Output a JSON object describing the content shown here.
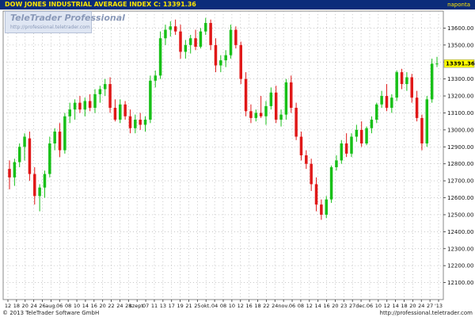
{
  "window": {
    "title": "DOW JONES INDUSTRIAL AVERAGE INDEX C: 13391.36",
    "period": "napontа"
  },
  "watermark": {
    "brand": "TeleTrader Professional",
    "url": "http://professional.teletrader.com"
  },
  "footer": {
    "copyright": "© 2013 TeleTrader Software GmbH",
    "url": "http://professional.teletrader.com"
  },
  "colors": {
    "header_bg": "#0b2c7a",
    "header_text": "#ffe600",
    "up_candle": "#18c018",
    "down_candle": "#e01818",
    "grid": "#b4b4b4",
    "price_tag": "#ffff00"
  },
  "chart_data": {
    "type": "candlestick",
    "title": "DOW JONES INDUSTRIAL AVERAGE INDEX",
    "last_price_label": "13391.36",
    "ylim": [
      12000,
      13700
    ],
    "y_ticks": [
      {
        "value": 13600,
        "label": "13600.00"
      },
      {
        "value": 13500,
        "label": "13500.00"
      },
      {
        "value": 13400,
        "label": "13400.00"
      },
      {
        "value": 13300,
        "label": "13300.00"
      },
      {
        "value": 13200,
        "label": "13200.00"
      },
      {
        "value": 13100,
        "label": "13100.00"
      },
      {
        "value": 13000,
        "label": "13000.00"
      },
      {
        "value": 12900,
        "label": "12900.00"
      },
      {
        "value": 12800,
        "label": "12800.00"
      },
      {
        "value": 12700,
        "label": "12700.00"
      },
      {
        "value": 12600,
        "label": "12600.00"
      },
      {
        "value": 12500,
        "label": "12500.00"
      },
      {
        "value": 12400,
        "label": "12400.00"
      },
      {
        "value": 12300,
        "label": "12300.00"
      },
      {
        "value": 12200,
        "label": "12200.00"
      },
      {
        "value": 12100,
        "label": "12100.00"
      }
    ],
    "x_labels": [
      "12",
      "18",
      "20",
      "24",
      "26",
      "aug.",
      "06",
      "08",
      "10",
      "14",
      "16",
      "20",
      "22",
      "24",
      "28",
      "szept.",
      "07",
      "11",
      "13",
      "17",
      "19",
      "21",
      "25",
      "okt.",
      "04",
      "08",
      "10",
      "12",
      "16",
      "18",
      "22",
      "24",
      "nov.",
      "06",
      "08",
      "12",
      "14",
      "16",
      "20",
      "23",
      "27",
      "dec.",
      "06",
      "10",
      "12",
      "14",
      "18",
      "20",
      "24",
      "27",
      "'13"
    ],
    "candles": [
      {
        "o": 12770,
        "h": 12820,
        "l": 12650,
        "c": 12720
      },
      {
        "o": 12720,
        "h": 12830,
        "l": 12670,
        "c": 12810
      },
      {
        "o": 12810,
        "h": 12920,
        "l": 12780,
        "c": 12900
      },
      {
        "o": 12900,
        "h": 12980,
        "l": 12820,
        "c": 12960
      },
      {
        "o": 12950,
        "h": 12990,
        "l": 12700,
        "c": 12740
      },
      {
        "o": 12740,
        "h": 12780,
        "l": 12560,
        "c": 12610
      },
      {
        "o": 12610,
        "h": 12680,
        "l": 12520,
        "c": 12660
      },
      {
        "o": 12660,
        "h": 12760,
        "l": 12600,
        "c": 12740
      },
      {
        "o": 12740,
        "h": 12960,
        "l": 12720,
        "c": 12920
      },
      {
        "o": 12920,
        "h": 13010,
        "l": 12880,
        "c": 12990
      },
      {
        "o": 12990,
        "h": 13040,
        "l": 12840,
        "c": 12880
      },
      {
        "o": 12880,
        "h": 13100,
        "l": 12860,
        "c": 13080
      },
      {
        "o": 13080,
        "h": 13160,
        "l": 13040,
        "c": 13120
      },
      {
        "o": 13120,
        "h": 13180,
        "l": 13060,
        "c": 13160
      },
      {
        "o": 13160,
        "h": 13200,
        "l": 13100,
        "c": 13120
      },
      {
        "o": 13120,
        "h": 13190,
        "l": 13080,
        "c": 13170
      },
      {
        "o": 13170,
        "h": 13210,
        "l": 13110,
        "c": 13130
      },
      {
        "o": 13130,
        "h": 13240,
        "l": 13100,
        "c": 13210
      },
      {
        "o": 13210,
        "h": 13260,
        "l": 13160,
        "c": 13240
      },
      {
        "o": 13240,
        "h": 13300,
        "l": 13200,
        "c": 13270
      },
      {
        "o": 13270,
        "h": 13310,
        "l": 13100,
        "c": 13130
      },
      {
        "o": 13130,
        "h": 13180,
        "l": 13050,
        "c": 13060
      },
      {
        "o": 13060,
        "h": 13180,
        "l": 13040,
        "c": 13150
      },
      {
        "o": 13150,
        "h": 13170,
        "l": 13060,
        "c": 13080
      },
      {
        "o": 13080,
        "h": 13120,
        "l": 12980,
        "c": 13010
      },
      {
        "o": 13010,
        "h": 13090,
        "l": 12980,
        "c": 13060
      },
      {
        "o": 13060,
        "h": 13100,
        "l": 13000,
        "c": 13030
      },
      {
        "o": 13030,
        "h": 13080,
        "l": 12990,
        "c": 13060
      },
      {
        "o": 13060,
        "h": 13320,
        "l": 13040,
        "c": 13290
      },
      {
        "o": 13290,
        "h": 13350,
        "l": 13250,
        "c": 13320
      },
      {
        "o": 13320,
        "h": 13580,
        "l": 13300,
        "c": 13540
      },
      {
        "o": 13540,
        "h": 13620,
        "l": 13500,
        "c": 13590
      },
      {
        "o": 13590,
        "h": 13640,
        "l": 13550,
        "c": 13610
      },
      {
        "o": 13610,
        "h": 13650,
        "l": 13560,
        "c": 13580
      },
      {
        "o": 13580,
        "h": 13620,
        "l": 13420,
        "c": 13460
      },
      {
        "o": 13460,
        "h": 13530,
        "l": 13420,
        "c": 13500
      },
      {
        "o": 13500,
        "h": 13560,
        "l": 13450,
        "c": 13540
      },
      {
        "o": 13540,
        "h": 13590,
        "l": 13470,
        "c": 13490
      },
      {
        "o": 13490,
        "h": 13600,
        "l": 13480,
        "c": 13580
      },
      {
        "o": 13580,
        "h": 13660,
        "l": 13560,
        "c": 13630
      },
      {
        "o": 13630,
        "h": 13650,
        "l": 13470,
        "c": 13500
      },
      {
        "o": 13500,
        "h": 13540,
        "l": 13340,
        "c": 13380
      },
      {
        "o": 13380,
        "h": 13440,
        "l": 13340,
        "c": 13410
      },
      {
        "o": 13410,
        "h": 13470,
        "l": 13370,
        "c": 13440
      },
      {
        "o": 13440,
        "h": 13620,
        "l": 13420,
        "c": 13590
      },
      {
        "o": 13590,
        "h": 13610,
        "l": 13480,
        "c": 13500
      },
      {
        "o": 13500,
        "h": 13520,
        "l": 13270,
        "c": 13300
      },
      {
        "o": 13300,
        "h": 13340,
        "l": 13080,
        "c": 13110
      },
      {
        "o": 13110,
        "h": 13150,
        "l": 13040,
        "c": 13070
      },
      {
        "o": 13070,
        "h": 13120,
        "l": 13050,
        "c": 13100
      },
      {
        "o": 13100,
        "h": 13200,
        "l": 13070,
        "c": 13080
      },
      {
        "o": 13080,
        "h": 13170,
        "l": 13030,
        "c": 13140
      },
      {
        "o": 13140,
        "h": 13250,
        "l": 13120,
        "c": 13220
      },
      {
        "o": 13220,
        "h": 13260,
        "l": 13040,
        "c": 13060
      },
      {
        "o": 13060,
        "h": 13120,
        "l": 13020,
        "c": 13090
      },
      {
        "o": 13090,
        "h": 13300,
        "l": 13060,
        "c": 13280
      },
      {
        "o": 13280,
        "h": 13320,
        "l": 13100,
        "c": 13130
      },
      {
        "o": 13130,
        "h": 13160,
        "l": 12940,
        "c": 12960
      },
      {
        "o": 12960,
        "h": 12990,
        "l": 12820,
        "c": 12850
      },
      {
        "o": 12850,
        "h": 12880,
        "l": 12770,
        "c": 12800
      },
      {
        "o": 12800,
        "h": 12830,
        "l": 12640,
        "c": 12680
      },
      {
        "o": 12680,
        "h": 12720,
        "l": 12520,
        "c": 12560
      },
      {
        "o": 12560,
        "h": 12590,
        "l": 12470,
        "c": 12500
      },
      {
        "o": 12500,
        "h": 12610,
        "l": 12480,
        "c": 12590
      },
      {
        "o": 12590,
        "h": 12790,
        "l": 12570,
        "c": 12780
      },
      {
        "o": 12780,
        "h": 12850,
        "l": 12760,
        "c": 12820
      },
      {
        "o": 12820,
        "h": 12940,
        "l": 12800,
        "c": 12920
      },
      {
        "o": 12920,
        "h": 12980,
        "l": 12840,
        "c": 12860
      },
      {
        "o": 12860,
        "h": 12980,
        "l": 12840,
        "c": 12960
      },
      {
        "o": 12960,
        "h": 13030,
        "l": 12930,
        "c": 13000
      },
      {
        "o": 13000,
        "h": 13050,
        "l": 12900,
        "c": 12920
      },
      {
        "o": 12920,
        "h": 13020,
        "l": 12910,
        "c": 13010
      },
      {
        "o": 13010,
        "h": 13080,
        "l": 12980,
        "c": 13060
      },
      {
        "o": 13060,
        "h": 13160,
        "l": 13040,
        "c": 13150
      },
      {
        "o": 13150,
        "h": 13230,
        "l": 13130,
        "c": 13200
      },
      {
        "o": 13200,
        "h": 13270,
        "l": 13110,
        "c": 13130
      },
      {
        "o": 13130,
        "h": 13210,
        "l": 13100,
        "c": 13190
      },
      {
        "o": 13190,
        "h": 13350,
        "l": 13170,
        "c": 13340
      },
      {
        "o": 13340,
        "h": 13360,
        "l": 13240,
        "c": 13270
      },
      {
        "o": 13270,
        "h": 13340,
        "l": 13230,
        "c": 13310
      },
      {
        "o": 13310,
        "h": 13330,
        "l": 13160,
        "c": 13190
      },
      {
        "o": 13190,
        "h": 13230,
        "l": 13050,
        "c": 13070
      },
      {
        "o": 13070,
        "h": 13090,
        "l": 12880,
        "c": 12920
      },
      {
        "o": 12920,
        "h": 13200,
        "l": 12900,
        "c": 13180
      },
      {
        "o": 13180,
        "h": 13420,
        "l": 13160,
        "c": 13390
      },
      {
        "o": 13390,
        "h": 13430,
        "l": 13370,
        "c": 13391
      }
    ]
  }
}
